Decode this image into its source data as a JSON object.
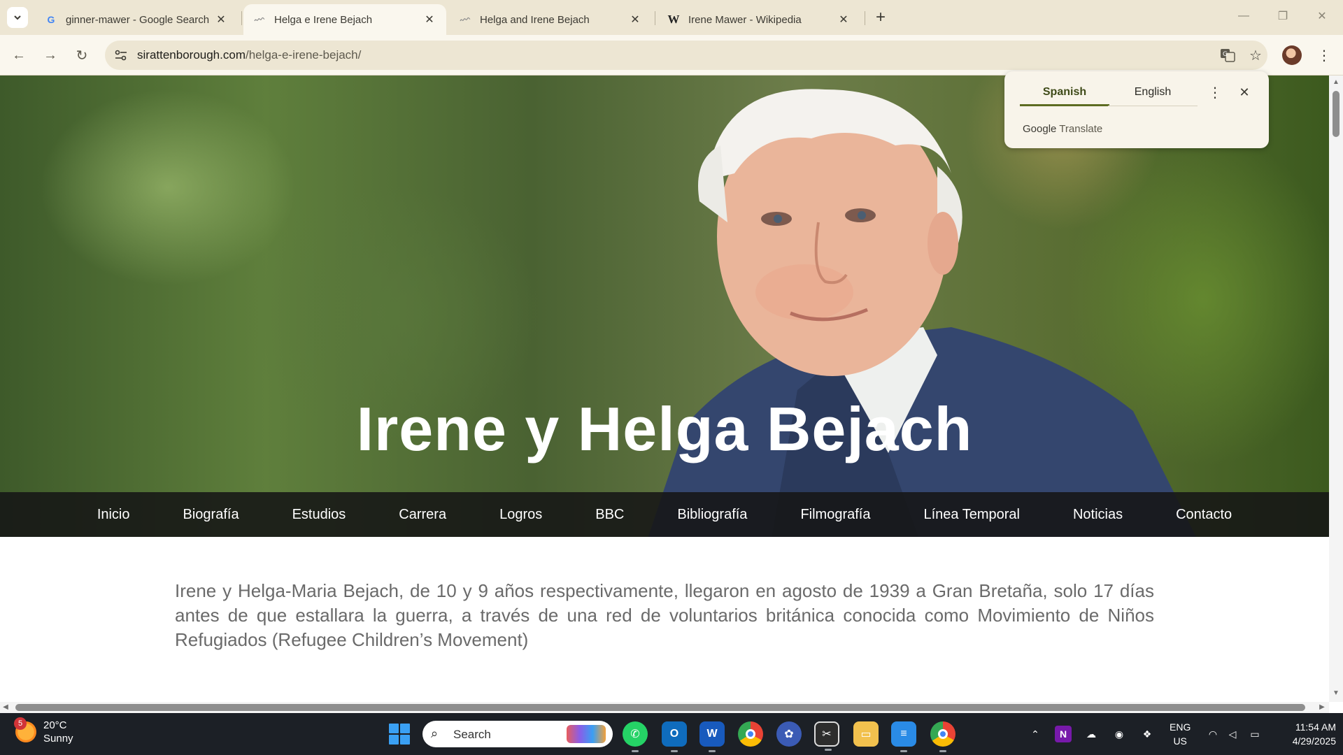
{
  "browser": {
    "tabs": [
      {
        "title": "ginner-mawer - Google Search",
        "favicon": "google-g-icon"
      },
      {
        "title": "Helga e Irene Bejach",
        "favicon": "site-favicon",
        "active": true
      },
      {
        "title": "Helga and Irene Bejach",
        "favicon": "site-favicon"
      },
      {
        "title": "Irene Mawer - Wikipedia",
        "favicon": "wikipedia-w-icon"
      }
    ],
    "favicon_letters": {
      "google": "G",
      "wikipedia": "W"
    },
    "address": {
      "domain": "sirattenborough.com",
      "path": "/helga-e-irene-bejach/"
    }
  },
  "translate_popup": {
    "source_lang": "Spanish",
    "target_lang": "English",
    "brand_google": "Google",
    "brand_translate": "Translate"
  },
  "page": {
    "hero_title": "Irene y Helga Bejach",
    "nav": [
      "Inicio",
      "Biografía",
      "Estudios",
      "Carrera",
      "Logros",
      "BBC",
      "Bibliografía",
      "Filmografía",
      "Línea Temporal",
      "Noticias",
      "Contacto"
    ],
    "intro": "Irene y Helga-Maria Bejach, de 10 y 9 años respectivamente, llegaron en agosto de 1939 a Gran Bretaña, solo 17 días antes de que estallara la guerra, a través de una red de voluntarios británica conocida como Movimiento de Niños Refugiados (Refugee Children’s Movement)"
  },
  "taskbar": {
    "weather": {
      "temp": "20°C",
      "condition": "Sunny",
      "badge": "5"
    },
    "search_label": "Search",
    "language": {
      "line1": "ENG",
      "line2": "US"
    },
    "clock": {
      "time": "11:54 AM",
      "date": "4/29/2025"
    },
    "apps": [
      "whatsapp-icon",
      "outlook-icon",
      "word-icon",
      "chrome-icon",
      "app-icon",
      "snipping-icon",
      "file-explorer-icon",
      "notepad-icon",
      "chrome-profile-icon"
    ],
    "app_letters": {
      "word": "W",
      "outlook": "O",
      "onenote": "N"
    }
  },
  "colors": {
    "accent_tab_underline": "#5d6c22",
    "taskbar": "#1c2026",
    "nav_bar": "#161616"
  }
}
